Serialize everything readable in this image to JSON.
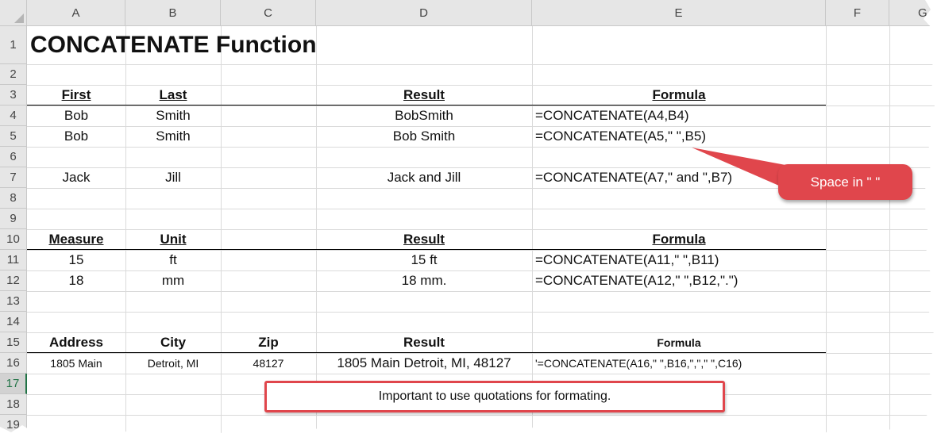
{
  "columns": [
    "A",
    "B",
    "C",
    "D",
    "E",
    "F",
    "G"
  ],
  "rows": [
    "1",
    "2",
    "3",
    "4",
    "5",
    "6",
    "7",
    "8",
    "9",
    "10",
    "11",
    "12",
    "13",
    "14",
    "15",
    "16",
    "17",
    "18",
    "19"
  ],
  "selected_row": "17",
  "title": "CONCATENATE Function",
  "section1": {
    "headers": {
      "first": "First",
      "last": "Last",
      "result": "Result",
      "formula": "Formula"
    },
    "rows": [
      {
        "a": "Bob",
        "b": "Smith",
        "result": "BobSmith",
        "formula": "=CONCATENATE(A4,B4)"
      },
      {
        "a": "Bob",
        "b": "Smith",
        "result": "Bob Smith",
        "formula": "=CONCATENATE(A5,\" \",B5)"
      },
      {
        "a": "Jack",
        "b": "Jill",
        "result": "Jack and Jill",
        "formula": "=CONCATENATE(A7,\" and \",B7)"
      }
    ]
  },
  "section2": {
    "headers": {
      "measure": "Measure",
      "unit": "Unit",
      "result": "Result",
      "formula": "Formula"
    },
    "rows": [
      {
        "a": "15",
        "b": "ft",
        "result": "15 ft",
        "formula": "=CONCATENATE(A11,\" \",B11)"
      },
      {
        "a": "18",
        "b": "mm",
        "result": "18 mm.",
        "formula": "=CONCATENATE(A12,\" \",B12,\".\")"
      }
    ]
  },
  "section3": {
    "headers": {
      "address": "Address",
      "city": "City",
      "zip": "Zip",
      "result": "Result",
      "formula": "Formula"
    },
    "row": {
      "a": "1805 Main",
      "b": "Detroit, MI",
      "c": "48127",
      "result": "1805 Main Detroit, MI, 48127",
      "formula": "'=CONCATENATE(A16,\" \",B16,\",\",\" \",C16)"
    }
  },
  "callout_text": "Space in \" \"",
  "note_text": "Important to use quotations for formating.",
  "colors": {
    "callout": "#e0464c",
    "header_bg": "#e6e6e6",
    "selected_row": "#217346"
  }
}
